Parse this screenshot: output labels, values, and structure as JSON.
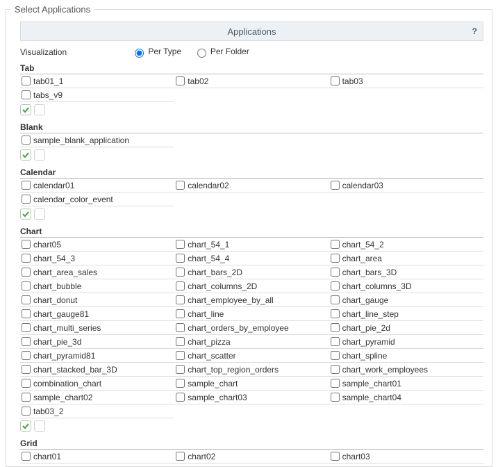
{
  "fieldset_legend": "Select Applications",
  "header": {
    "title": "Applications",
    "help": "?"
  },
  "visualization": {
    "label": "Visualization",
    "options": {
      "per_type": "Per Type",
      "per_folder": "Per Folder"
    },
    "selected": "per_type"
  },
  "sections": [
    {
      "title": "Tab",
      "items": [
        "tab01_1",
        "tab02",
        "tab03",
        "tabs_v9"
      ]
    },
    {
      "title": "Blank",
      "items": [
        "sample_blank_application"
      ]
    },
    {
      "title": "Calendar",
      "items": [
        "calendar01",
        "calendar02",
        "calendar03",
        "calendar_color_event"
      ]
    },
    {
      "title": "Chart",
      "items": [
        "chart05",
        "chart_54_1",
        "chart_54_2",
        "chart_54_3",
        "chart_54_4",
        "chart_area",
        "chart_area_sales",
        "chart_bars_2D",
        "chart_bars_3D",
        "chart_bubble",
        "chart_columns_2D",
        "chart_columns_3D",
        "chart_donut",
        "chart_employee_by_all",
        "chart_gauge",
        "chart_gauge81",
        "chart_line",
        "chart_line_step",
        "chart_multi_series",
        "chart_orders_by_employee",
        "chart_pie_2d",
        "chart_pie_3d",
        "chart_pizza",
        "chart_pyramid",
        "chart_pyramid81",
        "chart_scatter",
        "chart_spline",
        "chart_stacked_bar_3D",
        "chart_top_region_orders",
        "chart_work_employees",
        "combination_chart",
        "sample_chart",
        "sample_chart01",
        "sample_chart02",
        "sample_chart03",
        "sample_chart04",
        "tab03_2"
      ]
    },
    {
      "title": "Grid",
      "items": [
        "chart01",
        "chart02",
        "chart03"
      ]
    }
  ]
}
